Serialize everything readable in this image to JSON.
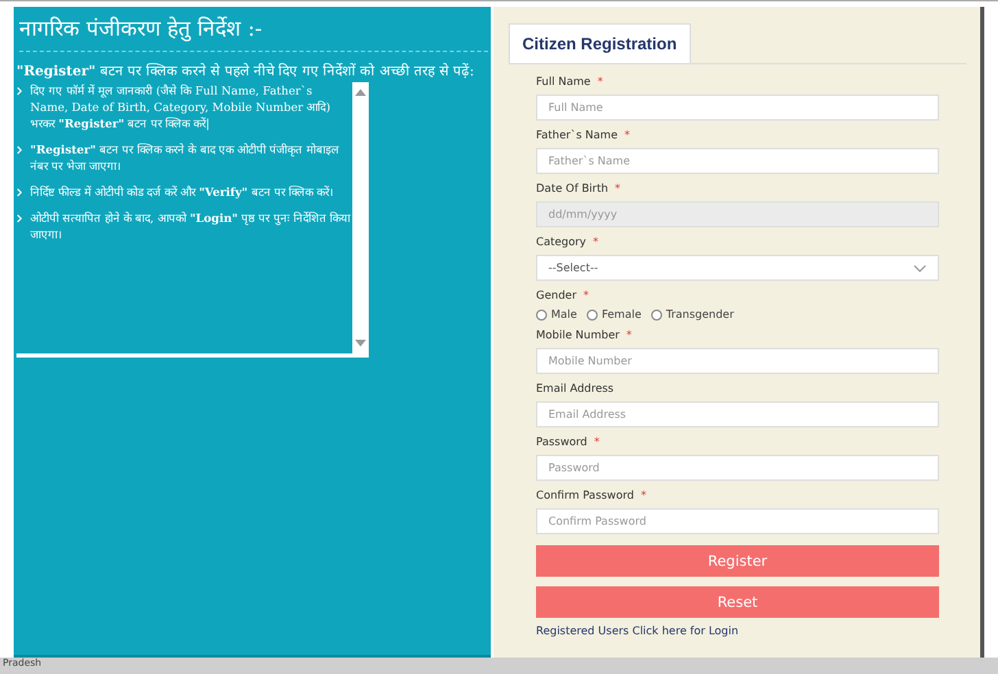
{
  "instructions": {
    "title": "नागरिक पंजीकरण हेतु निर्देश :-",
    "intro": "**\"Register\"** बटन पर क्लिक करने से पहले नीचे दिए गए निर्देशों को अच्छी तरह से पढ़ें:",
    "items": [
      "दिए गए फॉर्म में मूल जानकारी (जैसे कि Full Name, Father`s Name, Date of Birth, Category, Mobile Number आदि) भरकर **\"Register\"** बटन पर क्लिक करें|",
      "**\"Register\"** बटन पर क्लिक करने के बाद एक ओटीपी पंजीकृत मोबाइल नंबर पर भेजा जाएगा।",
      "निर्दिष्ट फील्ड में ओटीपी कोड दर्ज करें और **\"Verify\"** बटन पर क्लिक करें।",
      "ओटीपी सत्यापित होने के बाद, आपको **\"Login\"** पृष्ठ पर पुनः निर्देशित किया जाएगा।"
    ]
  },
  "form": {
    "tab": "Citizen Registration",
    "required_mark": "*",
    "fields": [
      {
        "kind": "text",
        "label": "Full Name",
        "required": true,
        "placeholder": "Full Name"
      },
      {
        "kind": "text",
        "label": "Father`s Name",
        "required": true,
        "placeholder": "Father`s Name"
      },
      {
        "kind": "text",
        "label": "Date Of Birth",
        "required": true,
        "placeholder": "dd/mm/yyyy",
        "disabled": true
      },
      {
        "kind": "select",
        "label": "Category",
        "required": true,
        "value": "--Select--"
      },
      {
        "kind": "radio",
        "label": "Gender",
        "required": true,
        "options": [
          {
            "label": "Male",
            "selected": false
          },
          {
            "label": "Female",
            "selected": false
          },
          {
            "label": "Transgender",
            "selected": false
          }
        ]
      },
      {
        "kind": "text",
        "label": "Mobile Number",
        "required": true,
        "placeholder": "Mobile Number"
      },
      {
        "kind": "text",
        "label": "Email Address",
        "required": false,
        "placeholder": "Email Address"
      },
      {
        "kind": "text",
        "label": "Password",
        "required": true,
        "placeholder": "Password"
      },
      {
        "kind": "text",
        "label": "Confirm Password",
        "required": true,
        "placeholder": "Confirm Password"
      }
    ],
    "buttons": [
      "Register",
      "Reset"
    ],
    "login_link": "Registered Users Click here for Login"
  },
  "footer": {
    "text": "Pradesh"
  }
}
